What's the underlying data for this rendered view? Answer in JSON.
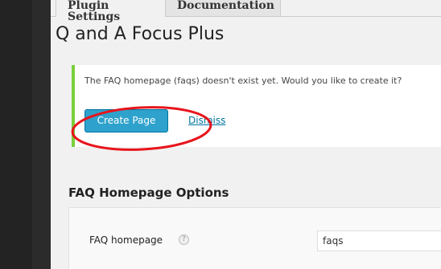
{
  "tabs": [
    {
      "label": "Plugin Settings",
      "active": true
    },
    {
      "label": "Documentation",
      "active": false
    }
  ],
  "page": {
    "title": "Q and A Focus Plus"
  },
  "notice": {
    "message": "The FAQ homepage (faqs) doesn't exist yet. Would you like to create it?",
    "create_label": "Create Page",
    "dismiss_label": "Dismiss",
    "accent_color": "#7ad03a"
  },
  "options": {
    "heading": "FAQ Homepage Options",
    "fields": [
      {
        "label": "FAQ homepage",
        "help_icon": "help-icon",
        "help_glyph": "?",
        "value": "faqs"
      }
    ]
  },
  "colors": {
    "button": "#2ea2cc",
    "link": "#0074a2",
    "annotation": "#e8141b"
  }
}
